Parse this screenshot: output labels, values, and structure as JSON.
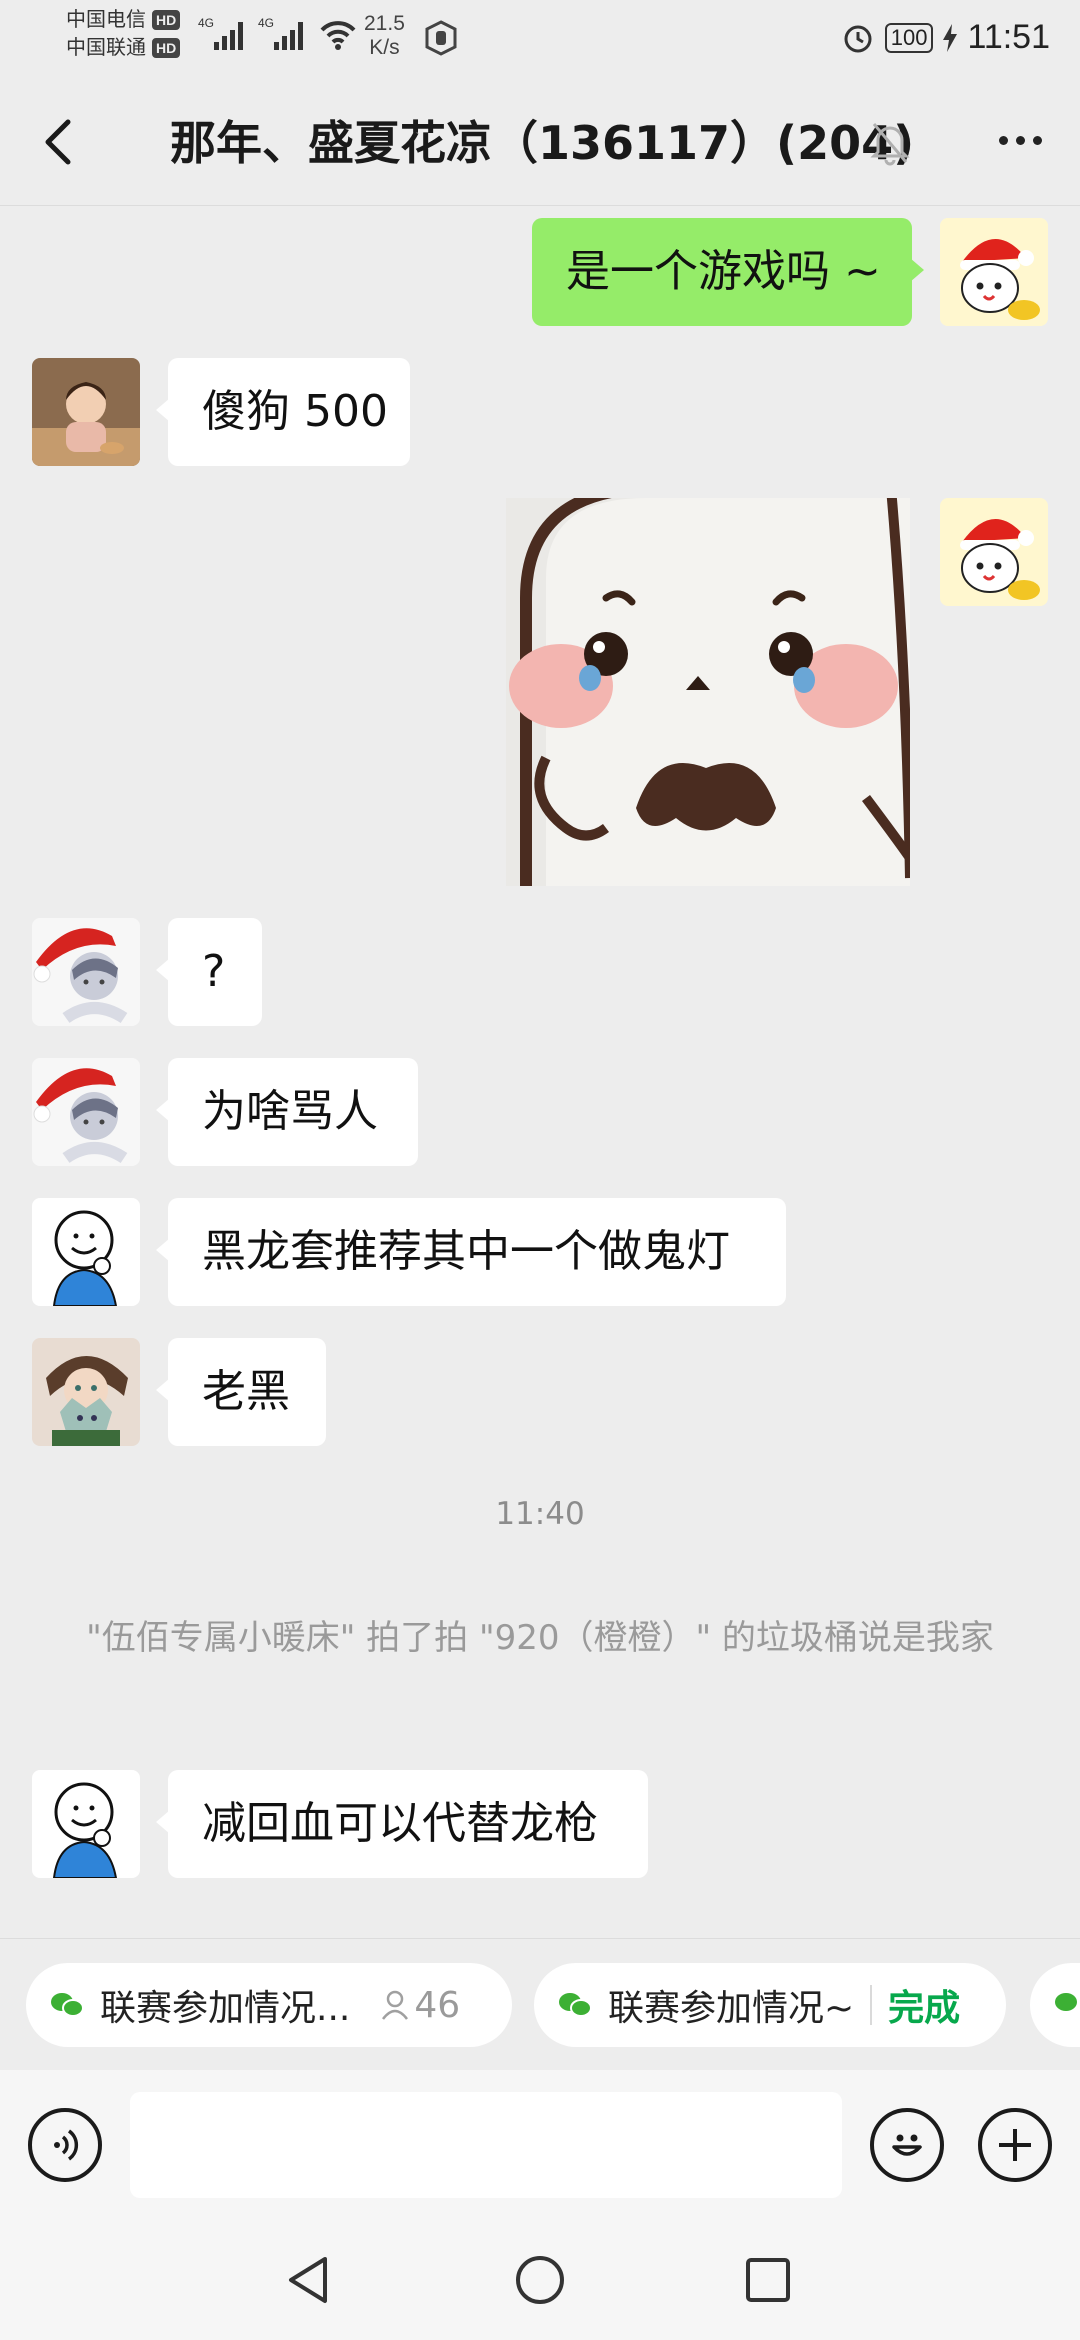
{
  "status_bar": {
    "carrier1": "中国电信",
    "carrier2": "中国联通",
    "hd_badge": "HD",
    "network1": "4G",
    "network2": "4G",
    "speed_value": "21.5",
    "speed_unit": "K/s",
    "battery": "100",
    "time": "11:51"
  },
  "header": {
    "title": "那年、盛夏花凉（136117）(204)",
    "icons": [
      "back-arrow-icon",
      "mute-bell-icon",
      "more-dots-icon"
    ]
  },
  "messages": [
    {
      "side": "me",
      "text": "是一个游戏吗 ~"
    },
    {
      "side": "them",
      "text": "傻狗 500"
    },
    {
      "side": "me",
      "type": "sticker"
    },
    {
      "side": "them",
      "text": "?"
    },
    {
      "side": "them",
      "text": "为啥骂人"
    },
    {
      "side": "them",
      "text": "黑龙套推荐其中一个做鬼灯"
    },
    {
      "side": "them",
      "text": "老黑"
    },
    {
      "side": "them",
      "text": "减回血可以代替龙枪"
    }
  ],
  "timestamp": "11:40",
  "system_message": "\"伍佰专属小暖床\" 拍了拍 \"920（橙橙）\" 的垃圾桶说是我家",
  "chips": [
    {
      "label": "联赛参加情况...",
      "count": "46"
    },
    {
      "label": "联赛参加情况~",
      "status": "完成"
    }
  ],
  "input": {
    "value": "",
    "placeholder": ""
  },
  "colors": {
    "background": "#ededed",
    "my_bubble": "#95ec69",
    "their_bubble": "#ffffff",
    "done_green": "#07a84c"
  }
}
